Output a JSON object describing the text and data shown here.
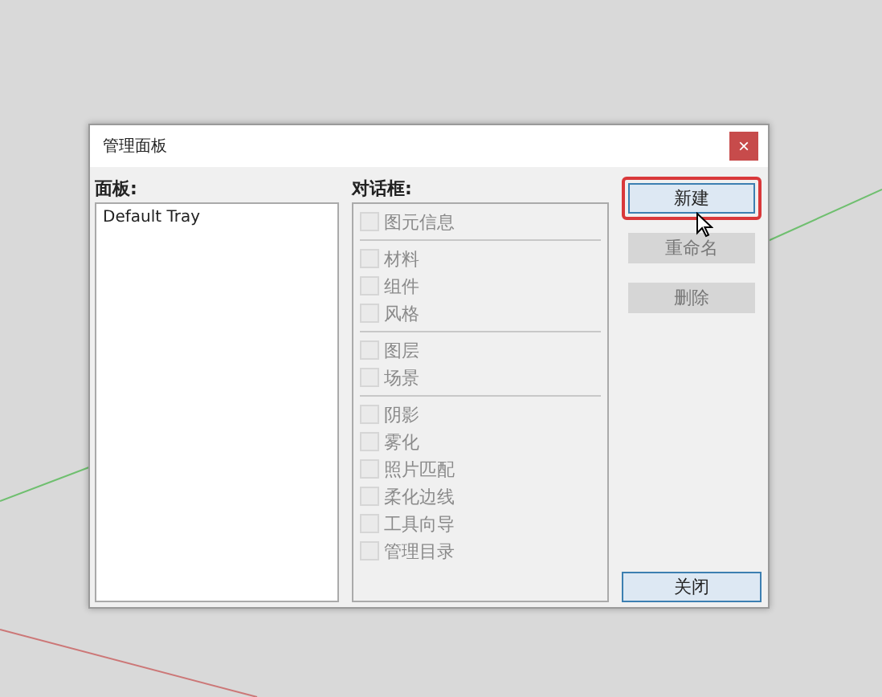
{
  "window": {
    "title": "管理面板",
    "close": "×"
  },
  "trays": {
    "label": "面板:",
    "items": [
      {
        "label": "Default Tray",
        "selected": false
      }
    ]
  },
  "dialogs": {
    "label": "对话框:",
    "groups": [
      [
        {
          "label": "图元信息",
          "checked": false,
          "disabled": true
        }
      ],
      [
        {
          "label": "材料",
          "checked": false,
          "disabled": true
        },
        {
          "label": "组件",
          "checked": false,
          "disabled": true
        },
        {
          "label": "风格",
          "checked": false,
          "disabled": true
        }
      ],
      [
        {
          "label": "图层",
          "checked": false,
          "disabled": true
        },
        {
          "label": "场景",
          "checked": false,
          "disabled": true
        }
      ],
      [
        {
          "label": "阴影",
          "checked": false,
          "disabled": true
        },
        {
          "label": "雾化",
          "checked": false,
          "disabled": true
        },
        {
          "label": "照片匹配",
          "checked": false,
          "disabled": true
        },
        {
          "label": "柔化边线",
          "checked": false,
          "disabled": true
        },
        {
          "label": "工具向导",
          "checked": false,
          "disabled": true
        },
        {
          "label": "管理目录",
          "checked": false,
          "disabled": true
        }
      ]
    ]
  },
  "buttons": [
    {
      "label": "新建",
      "disabled": false,
      "highlighted": true
    },
    {
      "label": "重命名",
      "disabled": true,
      "highlighted": false
    },
    {
      "label": "删除",
      "disabled": true,
      "highlighted": false
    }
  ],
  "close_button": {
    "label": "关闭",
    "disabled": false
  }
}
